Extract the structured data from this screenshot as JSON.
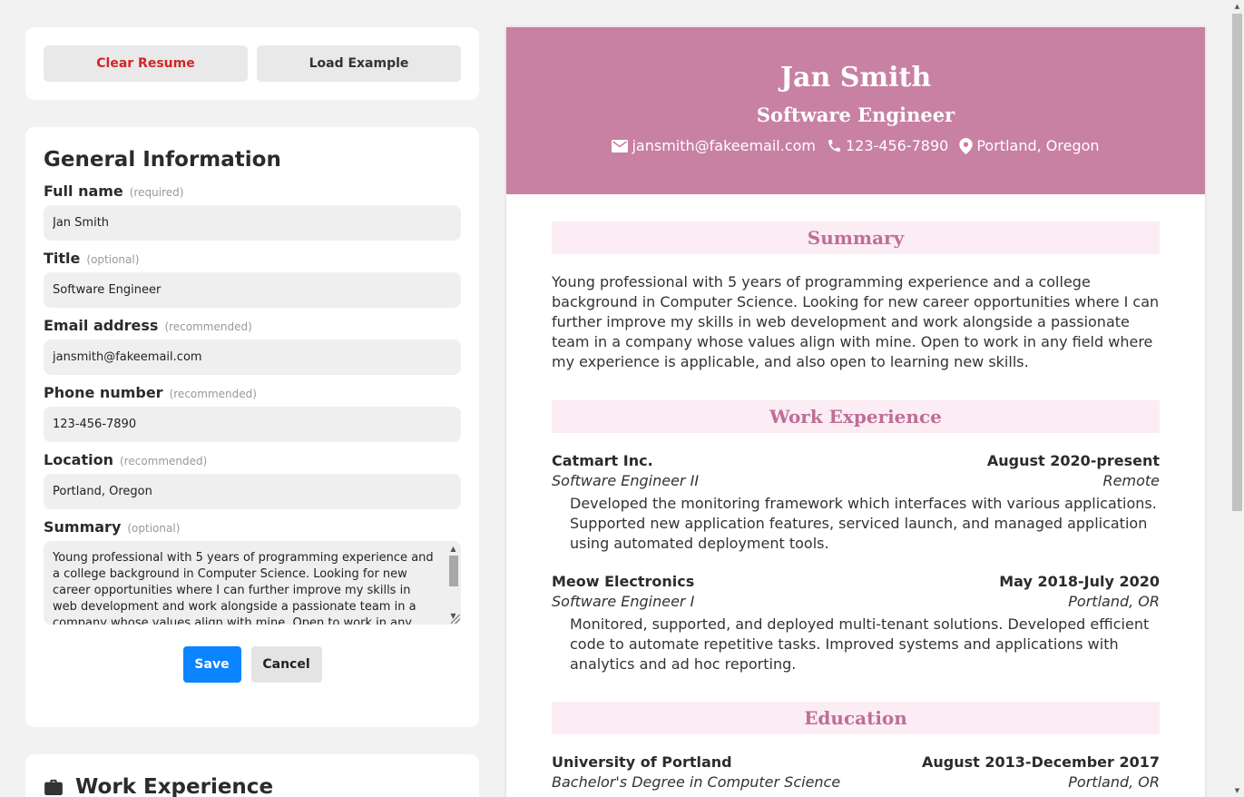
{
  "actions": {
    "clear_label": "Clear Resume",
    "load_label": "Load Example"
  },
  "form": {
    "title": "General Information",
    "fields": [
      {
        "label": "Full name",
        "hint": "(required)",
        "value": "Jan Smith"
      },
      {
        "label": "Title",
        "hint": "(optional)",
        "value": "Software Engineer"
      },
      {
        "label": "Email address",
        "hint": "(recommended)",
        "value": "jansmith@fakeemail.com"
      },
      {
        "label": "Phone number",
        "hint": "(recommended)",
        "value": "123-456-7890"
      },
      {
        "label": "Location",
        "hint": "(recommended)",
        "value": "Portland, Oregon"
      }
    ],
    "summary": {
      "label": "Summary",
      "hint": "(optional)",
      "value": "Young professional with 5 years of programming experience and a college background in Computer Science. Looking for new career opportunities where I can further improve my skills in web development and work alongside a passionate team in a company whose values align with mine. Open to work in any field where my"
    },
    "save_label": "Save",
    "cancel_label": "Cancel"
  },
  "work_section": {
    "title": "Work Experience",
    "icon": "briefcase-icon"
  },
  "resume": {
    "name": "Jan Smith",
    "title": "Software Engineer",
    "email": "jansmith@fakeemail.com",
    "phone": "123-456-7890",
    "location": "Portland, Oregon",
    "header_color": "#c880a3",
    "accent_color": "#c06d98",
    "summary_heading": "Summary",
    "summary_text": "Young professional with 5 years of programming experience and a college background in Computer Science. Looking for new career opportunities where I can further improve my skills in web development and work alongside a passionate team in a company whose values align with mine. Open to work in any field where my experience is applicable, and also open to learning new skills.",
    "work_heading": "Work Experience",
    "jobs": [
      {
        "company": "Catmart Inc.",
        "dates": "August 2020-present",
        "position": "Software Engineer II",
        "location": "Remote",
        "description": "Developed the monitoring framework which interfaces with various applications. Supported new application features, serviced launch, and managed application using automated deployment tools."
      },
      {
        "company": "Meow Electronics",
        "dates": "May 2018-July 2020",
        "position": "Software Engineer I",
        "location": "Portland, OR",
        "description": "Monitored, supported, and deployed multi-tenant solutions. Developed efficient code to automate repetitive tasks. Improved systems and applications with analytics and ad hoc reporting."
      }
    ],
    "education_heading": "Education",
    "education": [
      {
        "school": "University of Portland",
        "dates": "August 2013-December 2017",
        "degree": "Bachelor's Degree in Computer Science",
        "location": "Portland, OR"
      }
    ]
  }
}
